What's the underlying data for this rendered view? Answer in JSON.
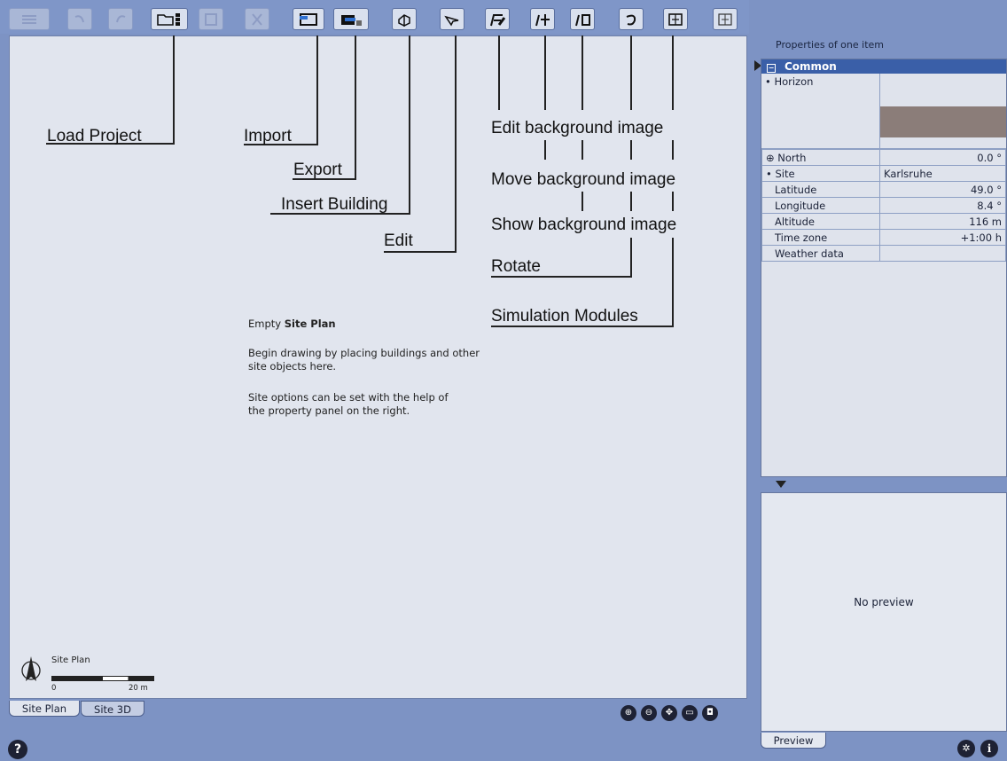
{
  "toolbar": {
    "buttons": [
      "layers-icon",
      "undo-icon",
      "redo-icon",
      "open-folder-icon",
      "save-icon",
      "delete-icon",
      "import-icon",
      "export-icon",
      "insert-building-icon",
      "edit-pointer-icon",
      "edit-background-image-icon",
      "move-background-image-icon",
      "show-background-image-icon",
      "rotate-icon",
      "simulation-module-1-icon",
      "simulation-module-2-icon"
    ]
  },
  "annotations": {
    "load_project": "Load Project",
    "import": "Import",
    "export": "Export",
    "insert_building": "Insert Building",
    "edit": "Edit",
    "edit_bg": "Edit background image",
    "move_bg": "Move background image",
    "show_bg": "Show background image",
    "rotate": "Rotate",
    "simulation_modules": "Simulation Modules"
  },
  "empty_state": {
    "title_prefix": "Empty ",
    "title_bold": "Site Plan",
    "line1": "Begin drawing by placing buildings and other",
    "line2": "site objects here.",
    "line3": "Site options can be set with the help of",
    "line4": "the property panel on the right."
  },
  "site_plan_legend": {
    "label": "Site Plan",
    "scale_start": "0",
    "scale_end": "20 m"
  },
  "tabs": {
    "site_plan": "Site Plan",
    "site_3d": "Site 3D",
    "preview": "Preview"
  },
  "properties": {
    "title": "Properties of one item",
    "group": "Common",
    "horizon": "Horizon",
    "rows": [
      {
        "name": "North",
        "value": "0.0 °"
      },
      {
        "name": "Site",
        "value": "Karlsruhe"
      },
      {
        "name": "Latitude",
        "value": "49.0 °"
      },
      {
        "name": "Longitude",
        "value": "8.4 °"
      },
      {
        "name": "Altitude",
        "value": "116 m"
      },
      {
        "name": "Time zone",
        "value": "+1:00 h"
      },
      {
        "name": "Weather data",
        "value": ""
      }
    ]
  },
  "preview": {
    "text": "No preview"
  },
  "help": "?",
  "colors": {
    "chrome": "#7f96c8",
    "canvas": "#e1e5ee",
    "group_header": "#3a5fa8",
    "horizon_strip": "#8b7d79"
  }
}
